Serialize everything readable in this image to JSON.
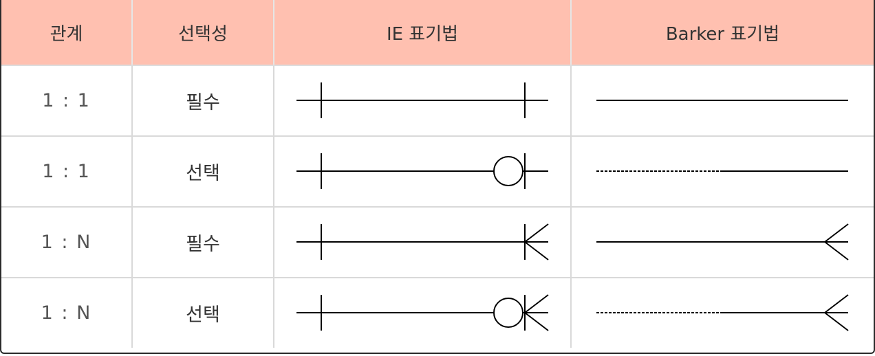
{
  "headers": {
    "relation": "관계",
    "optionality": "선택성",
    "ie": "IE 표기법",
    "barker": "Barker 표기법"
  },
  "rows": [
    {
      "relation": "1 : 1",
      "optionality": "필수",
      "ie_symbol": "one-mandatory-to-one-mandatory",
      "barker_symbol": "solid-line"
    },
    {
      "relation": "1 : 1",
      "optionality": "선택",
      "ie_symbol": "one-to-zero-or-one",
      "barker_symbol": "dashed-then-solid-line"
    },
    {
      "relation": "1 : N",
      "optionality": "필수",
      "ie_symbol": "one-to-one-or-many",
      "barker_symbol": "solid-line-crows-foot"
    },
    {
      "relation": "1 : N",
      "optionality": "선택",
      "ie_symbol": "one-to-zero-or-many",
      "barker_symbol": "dashed-then-solid-line-crows-foot"
    }
  ],
  "colors": {
    "header_bg": "#ffc0b0",
    "grid": "#d9d9d9",
    "line": "#000000"
  }
}
